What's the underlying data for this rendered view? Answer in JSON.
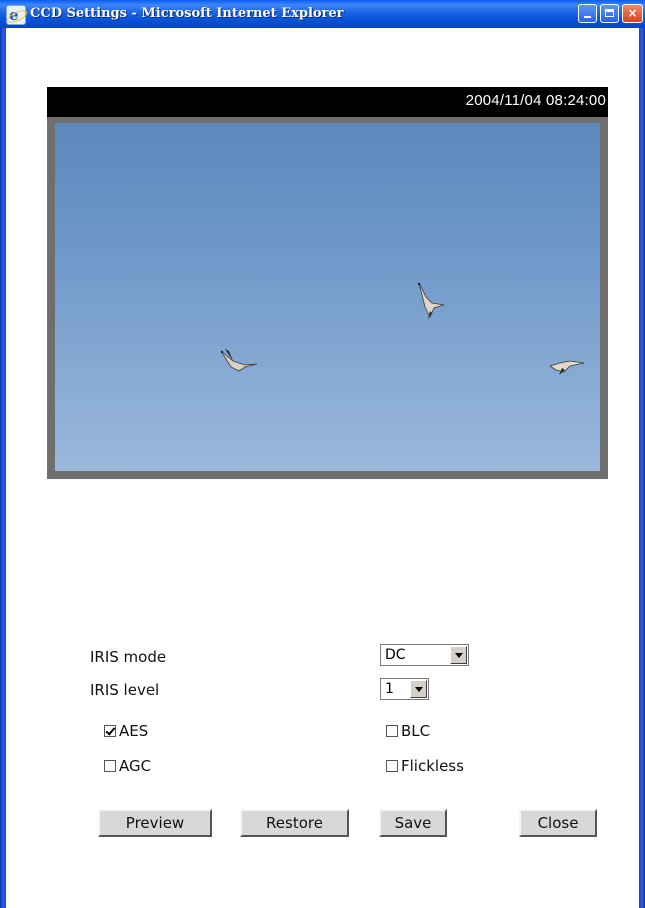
{
  "window": {
    "title": "CCD Settings - Microsoft Internet Explorer",
    "app_icon": "ie-icon",
    "controls": [
      "minimize-icon",
      "maximize-icon",
      "close-icon"
    ],
    "close_glyph": "×"
  },
  "video": {
    "timestamp": "2004/11/04 08:24:00",
    "scene": "blue sky with three flying birds"
  },
  "form": {
    "iris_mode": {
      "label": "IRIS mode",
      "value": "DC"
    },
    "iris_level": {
      "label": "IRIS level",
      "value": "1"
    },
    "checkboxes": [
      {
        "label": "AES",
        "checked": true
      },
      {
        "label": "BLC",
        "checked": false
      },
      {
        "label": "AGC",
        "checked": false
      },
      {
        "label": "Flickless",
        "checked": false
      }
    ]
  },
  "buttons": {
    "preview": "Preview",
    "restore": "Restore",
    "save": "Save",
    "close": "Close"
  },
  "colors": {
    "titlebar": "#0a5df0",
    "sky": "#6e97c8",
    "button_face": "#d8d8d8"
  }
}
